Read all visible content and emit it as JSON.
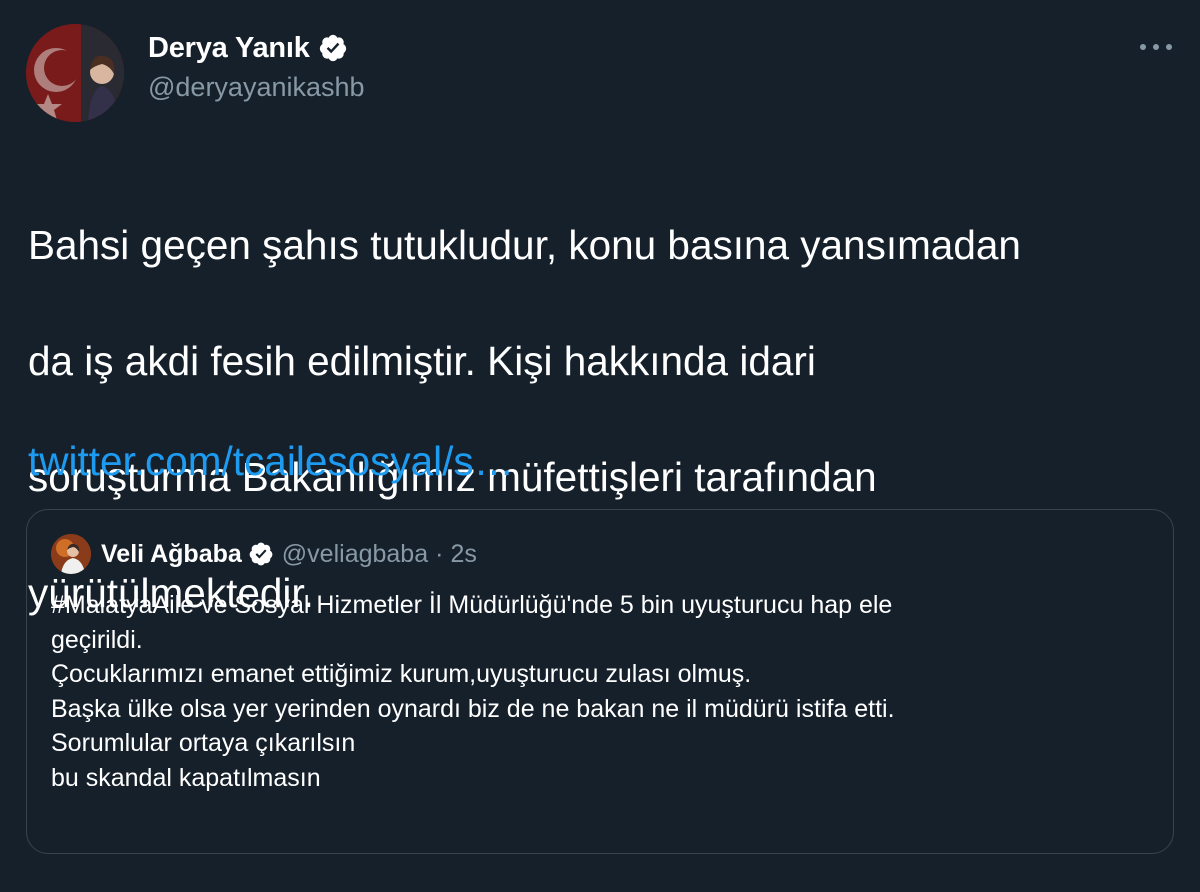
{
  "author": {
    "name": "Derya Yanık",
    "handle": "@deryayanikashb",
    "verified": true,
    "avatar_icon": "avatar-flag-portrait"
  },
  "menu": {
    "more_icon": "more-horizontal-icon"
  },
  "tweet": {
    "text": "Bahsi geçen şahıs tutukludur, konu basına yansımadan da iş akdi fesih edilmiştir. Kişi hakkında idari soruşturma Bakanlığımız müfettişleri tarafından yürütülmektedir.",
    "lines": [
      "Bahsi geçen şahıs tutukludur, konu basına yansımadan",
      "da iş akdi fesih edilmiştir. Kişi hakkında idari",
      "soruşturma Bakanlığımız müfettişleri tarafından",
      "yürütülmektedir."
    ],
    "link": "twitter.com/tcailesosyal/s…"
  },
  "quote": {
    "name": "Veli Ağbaba",
    "handle": "@veliagbaba",
    "dot": "·",
    "time": "2s",
    "verified": true,
    "lines": [
      "#MalatyaAile ve Sosyal Hizmetler İl Müdürlüğü'nde 5 bin uyuşturucu hap ele",
      "geçirildi.",
      "Çocuklarımızı emanet ettiğimiz kurum,uyuşturucu zulası olmuş.",
      "Başka ülke olsa yer yerinden oynardı biz de ne bakan ne il müdürü istifa etti.",
      "Sorumlular ortaya çıkarılsın",
      "bu skandal kapatılmasın"
    ]
  },
  "colors": {
    "background": "#15202b",
    "text": "#ffffff",
    "secondary": "#8899a6",
    "link": "#1d9bf0",
    "border": "#38444d"
  }
}
